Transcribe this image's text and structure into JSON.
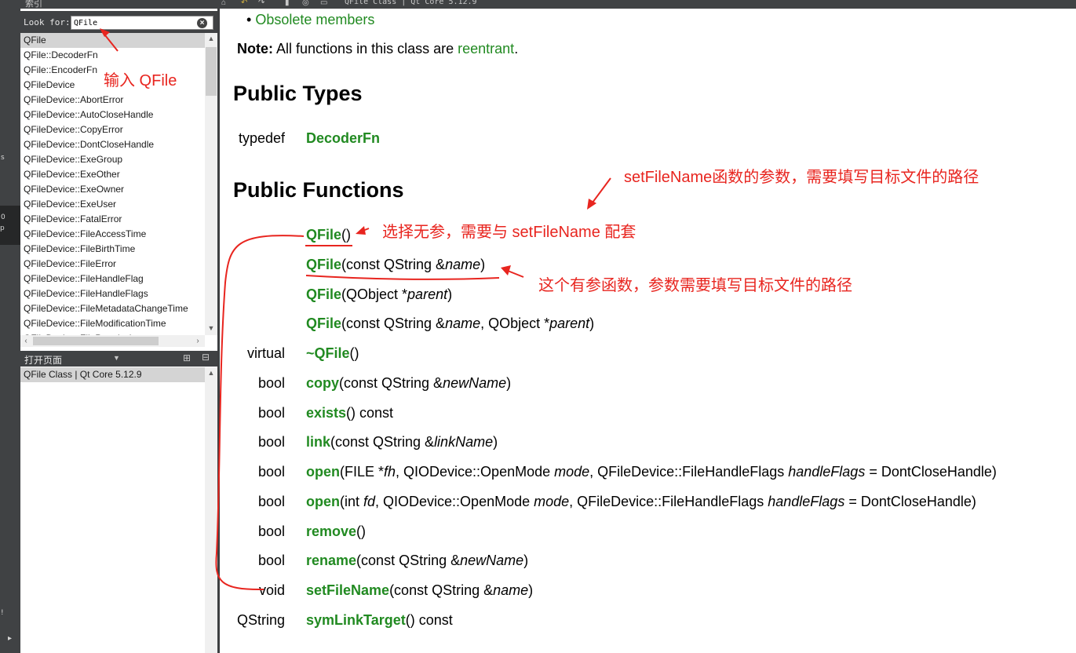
{
  "window": {
    "top_title": "QFile Class | Qt Core 5.12.9",
    "left_tab_label": "索引"
  },
  "index_panel": {
    "look_for_label": "Look for:",
    "search_value": "QFile",
    "items": [
      "QFile",
      "QFile::DecoderFn",
      "QFile::EncoderFn",
      "QFileDevice",
      "QFileDevice::AbortError",
      "QFileDevice::AutoCloseHandle",
      "QFileDevice::CopyError",
      "QFileDevice::DontCloseHandle",
      "QFileDevice::ExeGroup",
      "QFileDevice::ExeOther",
      "QFileDevice::ExeOwner",
      "QFileDevice::ExeUser",
      "QFileDevice::FatalError",
      "QFileDevice::FileAccessTime",
      "QFileDevice::FileBirthTime",
      "QFileDevice::FileError",
      "QFileDevice::FileHandleFlag",
      "QFileDevice::FileHandleFlags",
      "QFileDevice::FileMetadataChangeTime",
      "QFileDevice::FileModificationTime",
      "QFileDevice::FilePermissions"
    ]
  },
  "open_pages": {
    "title": "打开页面",
    "items": [
      "QFile Class | Qt Core 5.12.9"
    ]
  },
  "doc": {
    "obsolete_link": "Obsolete members",
    "note_bold": "Note:",
    "note_text": "All functions in this class are",
    "note_link": "reentrant",
    "note_end": ".",
    "public_types_heading": "Public Types",
    "typedef_kw": "typedef",
    "typedef_name": "DecoderFn",
    "public_functions_heading": "Public Functions",
    "functions": [
      {
        "ret": "",
        "name": "QFile",
        "params": [
          {
            "t": "()"
          }
        ]
      },
      {
        "ret": "",
        "name": "QFile",
        "params": [
          {
            "t": "(const QString &"
          },
          {
            "t": "name",
            "i": true
          },
          {
            "t": ")"
          }
        ]
      },
      {
        "ret": "",
        "name": "QFile",
        "params": [
          {
            "t": "(QObject *"
          },
          {
            "t": "parent",
            "i": true
          },
          {
            "t": ")"
          }
        ]
      },
      {
        "ret": "",
        "name": "QFile",
        "params": [
          {
            "t": "(const QString &"
          },
          {
            "t": "name",
            "i": true
          },
          {
            "t": ", QObject *"
          },
          {
            "t": "parent",
            "i": true
          },
          {
            "t": ")"
          }
        ]
      },
      {
        "ret": "virtual",
        "name": "~QFile",
        "params": [
          {
            "t": "()"
          }
        ]
      },
      {
        "ret": "bool",
        "name": "copy",
        "params": [
          {
            "t": "(const QString &"
          },
          {
            "t": "newName",
            "i": true
          },
          {
            "t": ")"
          }
        ]
      },
      {
        "ret": "bool",
        "name": "exists",
        "params": [
          {
            "t": "() const"
          }
        ]
      },
      {
        "ret": "bool",
        "name": "link",
        "params": [
          {
            "t": "(const QString &"
          },
          {
            "t": "linkName",
            "i": true
          },
          {
            "t": ")"
          }
        ]
      },
      {
        "ret": "bool",
        "name": "open",
        "params": [
          {
            "t": "(FILE *"
          },
          {
            "t": "fh",
            "i": true
          },
          {
            "t": ", QIODevice::OpenMode "
          },
          {
            "t": "mode",
            "i": true
          },
          {
            "t": ", QFileDevice::FileHandleFlags "
          },
          {
            "t": "handleFlags",
            "i": true
          },
          {
            "t": " = DontCloseHandle)"
          }
        ]
      },
      {
        "ret": "bool",
        "name": "open",
        "params": [
          {
            "t": "(int "
          },
          {
            "t": "fd",
            "i": true
          },
          {
            "t": ", QIODevice::OpenMode "
          },
          {
            "t": "mode",
            "i": true
          },
          {
            "t": ", QFileDevice::FileHandleFlags "
          },
          {
            "t": "handleFlags",
            "i": true
          },
          {
            "t": " = DontCloseHandle)"
          }
        ]
      },
      {
        "ret": "bool",
        "name": "remove",
        "params": [
          {
            "t": "()"
          }
        ]
      },
      {
        "ret": "bool",
        "name": "rename",
        "params": [
          {
            "t": "(const QString &"
          },
          {
            "t": "newName",
            "i": true
          },
          {
            "t": ")"
          }
        ]
      },
      {
        "ret": "void",
        "name": "setFileName",
        "params": [
          {
            "t": "(const QString &"
          },
          {
            "t": "name",
            "i": true
          },
          {
            "t": ")"
          }
        ]
      },
      {
        "ret": "QString",
        "name": "symLinkTarget",
        "params": [
          {
            "t": "() const"
          }
        ]
      }
    ]
  },
  "annotations": {
    "input_qfile": "输入 QFile",
    "setfilename_param": "setFileName函数的参数，需要填写目标文件的路径",
    "choose_no_param": "选择无参，需要与 setFileName 配套",
    "has_param": "这个有参函数，参数需要填写目标文件的路径",
    "color": "#e8251f"
  },
  "colors": {
    "link": "#218a21",
    "ide_dark": "#404244",
    "selection": "#d4d4d4"
  }
}
